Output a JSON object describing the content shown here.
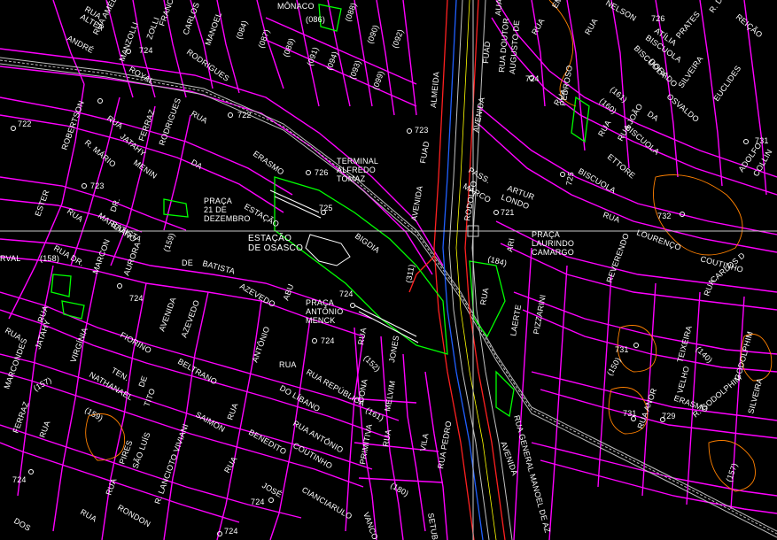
{
  "colors": {
    "background": "#000000",
    "block_outline": "#ff00ff",
    "label_text": "#ffffff",
    "green_area": "#00ff00",
    "contour": "#ff8000",
    "rail_line": "#c0c0c0",
    "red_line": "#ff2020",
    "blue_line": "#2060ff",
    "crosshair": "#c8c8c8"
  },
  "labels": [
    {
      "id": "rua-roberto",
      "text": "RUA\nALTER"
    },
    {
      "id": "andre",
      "text": "ANDRÉ"
    },
    {
      "id": "amelia",
      "text": "RUA AMÉLIA"
    },
    {
      "id": "manzolli",
      "text": "MANZOLLI"
    },
    {
      "id": "francisco",
      "text": "FRANCISCO"
    },
    {
      "id": "carlos",
      "text": "CARLOS"
    },
    {
      "id": "manoel",
      "text": "MANOEL"
    },
    {
      "id": "monaco",
      "text": "MÔNACO"
    },
    {
      "id": "p086",
      "text": "(086)"
    },
    {
      "id": "p084",
      "text": "(084)"
    },
    {
      "id": "p087",
      "text": "(087)"
    },
    {
      "id": "p089",
      "text": "(089)"
    },
    {
      "id": "p088",
      "text": "(088)"
    },
    {
      "id": "p091",
      "text": "(091)"
    },
    {
      "id": "p090",
      "text": "(090)"
    },
    {
      "id": "p094",
      "text": "(094)"
    },
    {
      "id": "p093",
      "text": "(093)"
    },
    {
      "id": "p092",
      "text": "(092)"
    },
    {
      "id": "p099",
      "text": "(099)"
    },
    {
      "id": "almeida",
      "text": "ALMEIDA"
    },
    {
      "id": "fuad",
      "text": "FUAD"
    },
    {
      "id": "auad",
      "text": "AUAD"
    },
    {
      "id": "doutor",
      "text": "RUA DOUTOR"
    },
    {
      "id": "augusto",
      "text": "AUGUSTO DE"
    },
    {
      "id": "emilio",
      "text": "EMÍLIO"
    },
    {
      "id": "rua-em",
      "text": "RUA"
    },
    {
      "id": "nelson",
      "text": "NELSON"
    },
    {
      "id": "e726",
      "text": "726"
    },
    {
      "id": "atilia",
      "text": "ATÍLIA"
    },
    {
      "id": "biscuola1",
      "text": "BISCUOLA"
    },
    {
      "id": "prates",
      "text": "PRATES"
    },
    {
      "id": "rua-r",
      "text": "RUA"
    },
    {
      "id": "reicao",
      "text": "REIÇÃO"
    },
    {
      "id": "rual",
      "text": "R. DA"
    },
    {
      "id": "e724a",
      "text": "724"
    },
    {
      "id": "e724b",
      "text": "724"
    },
    {
      "id": "zolli",
      "text": "ZOLLI"
    },
    {
      "id": "royal",
      "text": "ROYAL"
    },
    {
      "id": "rodrigues",
      "text": "RODRIGUES"
    },
    {
      "id": "rua1",
      "text": "RUA"
    },
    {
      "id": "e722a",
      "text": "722"
    },
    {
      "id": "e722b",
      "text": "722"
    },
    {
      "id": "rua-emb",
      "text": "RUA"
    },
    {
      "id": "pedroso",
      "text": "PEDROSO"
    },
    {
      "id": "p161",
      "text": "(161)"
    },
    {
      "id": "p160",
      "text": "(160)"
    },
    {
      "id": "rua-b",
      "text": "RUA"
    },
    {
      "id": "bisc2",
      "text": "BISCUOLA"
    },
    {
      "id": "dorado",
      "text": "DORADO"
    },
    {
      "id": "silveira",
      "text": "SILVEIRA"
    },
    {
      "id": "euclides",
      "text": "EUCLIDES"
    },
    {
      "id": "osvaldo",
      "text": "OSVALDO"
    },
    {
      "id": "da",
      "text": "DA"
    },
    {
      "id": "joao",
      "text": "RUA JOÃO"
    },
    {
      "id": "bisc3",
      "text": "BISCUOLA"
    },
    {
      "id": "ettore",
      "text": "ETTORE"
    },
    {
      "id": "e731a",
      "text": "731"
    },
    {
      "id": "adolfo",
      "text": "ADOLFO"
    },
    {
      "id": "collin",
      "text": "COLLIN"
    },
    {
      "id": "robertson",
      "text": "ROBERTSON"
    },
    {
      "id": "jatahy1",
      "text": "JATAHY"
    },
    {
      "id": "rua2",
      "text": "RUA"
    },
    {
      "id": "r-mario",
      "text": "R. MÁRIO"
    },
    {
      "id": "ferraz",
      "text": "FERRAZ"
    },
    {
      "id": "menin",
      "text": "MENIN"
    },
    {
      "id": "rodrigues2",
      "text": "RODRIGUES"
    },
    {
      "id": "da2",
      "text": "DA"
    },
    {
      "id": "erasmo",
      "text": "ERASMO"
    },
    {
      "id": "e723a",
      "text": "723"
    },
    {
      "id": "e723b",
      "text": "723"
    },
    {
      "id": "avenida1",
      "text": "AVENIDA"
    },
    {
      "id": "fuad2",
      "text": "FUAD"
    },
    {
      "id": "avenida2",
      "text": "AVENIDA"
    },
    {
      "id": "pass",
      "text": "PASS."
    },
    {
      "id": "marco",
      "text": "MARCO"
    },
    {
      "id": "rodolfo",
      "text": "RODOLFO"
    },
    {
      "id": "artur",
      "text": "ARTUR"
    },
    {
      "id": "londo",
      "text": "LONDO"
    },
    {
      "id": "e725",
      "text": "725"
    },
    {
      "id": "bisc4",
      "text": "BISCUOLA"
    },
    {
      "id": "e721",
      "text": "721"
    },
    {
      "id": "terminal",
      "text": "TERMINAL\nALFREDO\nTOMAZ"
    },
    {
      "id": "e726b",
      "text": "726"
    },
    {
      "id": "ester",
      "text": "ESTER"
    },
    {
      "id": "rua3",
      "text": "RUA"
    },
    {
      "id": "marciano",
      "text": "MARCIANO"
    },
    {
      "id": "dr",
      "text": "DR."
    },
    {
      "id": "batista",
      "text": "BATISTA"
    },
    {
      "id": "praca21",
      "text": "PRAÇA\n21 DE\nDEZEMBRO"
    },
    {
      "id": "estacao",
      "text": "ESTAÇÃO"
    },
    {
      "id": "e725b",
      "text": "725"
    },
    {
      "id": "bigo",
      "text": "BIGDIA"
    },
    {
      "id": "e732",
      "text": "732"
    },
    {
      "id": "rua4",
      "text": "RUA"
    },
    {
      "id": "lourenco",
      "text": "LOURENÇO"
    },
    {
      "id": "praca-laur",
      "text": "PRAÇA\nLAURINDO\nCAMARGO"
    },
    {
      "id": "estacao-os",
      "text": "ESTAÇÃO\nDE OSASCO"
    },
    {
      "id": "rua-dr",
      "text": "RUA DR."
    },
    {
      "id": "p158",
      "text": "(158)"
    },
    {
      "id": "marcon",
      "text": "MARCON"
    },
    {
      "id": "p159",
      "text": "(159)"
    },
    {
      "id": "aurora",
      "text": "AURORA"
    },
    {
      "id": "de",
      "text": "DE"
    },
    {
      "id": "batista2",
      "text": "BATISTA"
    },
    {
      "id": "p184",
      "text": "(184)"
    },
    {
      "id": "ari",
      "text": "ARI"
    },
    {
      "id": "reverendo",
      "text": "REVERENDO"
    },
    {
      "id": "coutinho",
      "text": "COUTINHO"
    },
    {
      "id": "carlos2",
      "text": "CARLOS D"
    },
    {
      "id": "rua5",
      "text": "RUA"
    },
    {
      "id": "rval",
      "text": "RVAL"
    },
    {
      "id": "p311",
      "text": "(311)"
    },
    {
      "id": "rua6",
      "text": "RUA"
    },
    {
      "id": "laerte",
      "text": "LAERTE"
    },
    {
      "id": "pizzarini",
      "text": "PIZZARINI"
    },
    {
      "id": "e724c",
      "text": "724"
    },
    {
      "id": "azevedo",
      "text": "AZEVEDO"
    },
    {
      "id": "abu",
      "text": "ABU"
    },
    {
      "id": "e724d",
      "text": "724"
    },
    {
      "id": "praca-ant",
      "text": "PRAÇA\nANTÔNIO\nMENCK"
    },
    {
      "id": "rua7",
      "text": "RUA"
    },
    {
      "id": "rua8",
      "text": "RUA"
    },
    {
      "id": "jatahy2",
      "text": "JATAHY"
    },
    {
      "id": "rua9",
      "text": "RUA"
    },
    {
      "id": "e724e",
      "text": "724"
    },
    {
      "id": "fiorino",
      "text": "FIORINO"
    },
    {
      "id": "azevedo2",
      "text": "AZEVEDO"
    },
    {
      "id": "avenida3",
      "text": "AVENIDA"
    },
    {
      "id": "antonio1",
      "text": "ANTÔNIO"
    },
    {
      "id": "rua10",
      "text": "RUA"
    },
    {
      "id": "p152",
      "text": "(152)"
    },
    {
      "id": "jones",
      "text": "JONES"
    },
    {
      "id": "e731b",
      "text": "731"
    },
    {
      "id": "teixeira",
      "text": "TEIXEIRA"
    },
    {
      "id": "p140",
      "text": "(140)"
    },
    {
      "id": "godolphim",
      "text": "GODOLPHIM"
    },
    {
      "id": "virginia",
      "text": "VIRGÍNIA"
    },
    {
      "id": "ten",
      "text": "TEN."
    },
    {
      "id": "beltrano",
      "text": "BELTRANO"
    },
    {
      "id": "republica",
      "text": "RUA REPÚBLICA"
    },
    {
      "id": "velho",
      "text": "VELHO"
    },
    {
      "id": "p150",
      "text": "(150)"
    },
    {
      "id": "marcondes",
      "text": "MARCONDES"
    },
    {
      "id": "nathanael",
      "text": "NATHANAEL"
    },
    {
      "id": "de2",
      "text": "DE"
    },
    {
      "id": "libano",
      "text": "DO LÍBANO"
    },
    {
      "id": "dona",
      "text": "DONA"
    },
    {
      "id": "melvin",
      "text": "MELVIM"
    },
    {
      "id": "erasmo2",
      "text": "ERASMO"
    },
    {
      "id": "p157",
      "text": "(157)"
    },
    {
      "id": "tito",
      "text": "TITO"
    },
    {
      "id": "p161b",
      "text": "(161)"
    },
    {
      "id": "silveira2",
      "text": "SILVEIRA"
    },
    {
      "id": "p159b",
      "text": "(159)"
    },
    {
      "id": "e731c",
      "text": "731"
    },
    {
      "id": "e729",
      "text": "729"
    },
    {
      "id": "anor",
      "text": "RUA ANOR"
    },
    {
      "id": "r-godolphim",
      "text": "R. GODOLPHIM"
    },
    {
      "id": "ferraz2",
      "text": "FERRAZ"
    },
    {
      "id": "rua11",
      "text": "RUA"
    },
    {
      "id": "saimon",
      "text": "SAIMON"
    },
    {
      "id": "rua12",
      "text": "RUA"
    },
    {
      "id": "antonio2",
      "text": "RUA ANTÔNIO"
    },
    {
      "id": "primitiva",
      "text": "PRIMITIVA"
    },
    {
      "id": "rua13",
      "text": "RUA"
    },
    {
      "id": "vila",
      "text": "VILA"
    },
    {
      "id": "rua-pedro",
      "text": "RUA PEDRO"
    },
    {
      "id": "avenida4",
      "text": "AVENIDA"
    },
    {
      "id": "general",
      "text": "RUA GENERAL MANOEL DE AZ"
    },
    {
      "id": "pires",
      "text": "PIRES"
    },
    {
      "id": "sao-luis",
      "text": "SÃO LUÍS"
    },
    {
      "id": "viviani",
      "text": "R. LANCIOTO VIVIANI"
    },
    {
      "id": "benedito",
      "text": "BENEDITO"
    },
    {
      "id": "coutinho2",
      "text": "COUTINHO"
    },
    {
      "id": "p157b",
      "text": "(157)"
    },
    {
      "id": "e724f",
      "text": "724"
    },
    {
      "id": "rua14",
      "text": "RUA"
    },
    {
      "id": "jose",
      "text": "JOSÉ"
    },
    {
      "id": "cianciarulo",
      "text": "CIANCIARULO"
    },
    {
      "id": "p180",
      "text": "(180)"
    },
    {
      "id": "vanco",
      "text": "VANCO"
    },
    {
      "id": "e724g",
      "text": "724"
    },
    {
      "id": "rua15",
      "text": "RUA"
    },
    {
      "id": "rondon",
      "text": "RONDON"
    },
    {
      "id": "dos",
      "text": "DOS"
    },
    {
      "id": "rua16",
      "text": "RUA"
    },
    {
      "id": "setubal",
      "text": "SETUBAL"
    },
    {
      "id": "e724h",
      "text": "724"
    }
  ]
}
